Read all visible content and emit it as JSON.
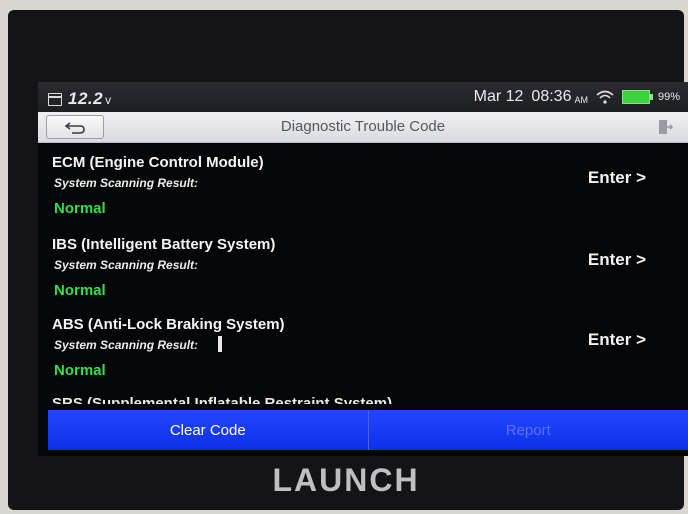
{
  "status_bar": {
    "voltage": "12.2",
    "voltage_unit": "v",
    "date": "Mar 12",
    "time": "08:36",
    "ampm": "AM",
    "battery_pct": "99%",
    "battery_color": "#3ed13e"
  },
  "header": {
    "title": "Diagnostic Trouble Code",
    "back_icon": "back-arrow-icon",
    "exit_icon": "exit-icon"
  },
  "systems": [
    {
      "name": "ECM (Engine Control Module)",
      "scan_label": "System Scanning Result:",
      "result": "Normal",
      "enter_label": "Enter >"
    },
    {
      "name": "IBS (Intelligent Battery System)",
      "scan_label": "System Scanning Result:",
      "result": "Normal",
      "enter_label": "Enter >"
    },
    {
      "name": "ABS (Anti-Lock Braking System)",
      "scan_label": "System Scanning Result:",
      "result": "Normal",
      "enter_label": "Enter >"
    }
  ],
  "partial_item": "SRS (Supplemental Inflatable Restraint System)",
  "actions": {
    "clear_code": "Clear Code",
    "report": "Report"
  },
  "brand": "LAUNCH",
  "colors": {
    "accent_blue": "#1637f5",
    "normal_green": "#2fe04a"
  }
}
